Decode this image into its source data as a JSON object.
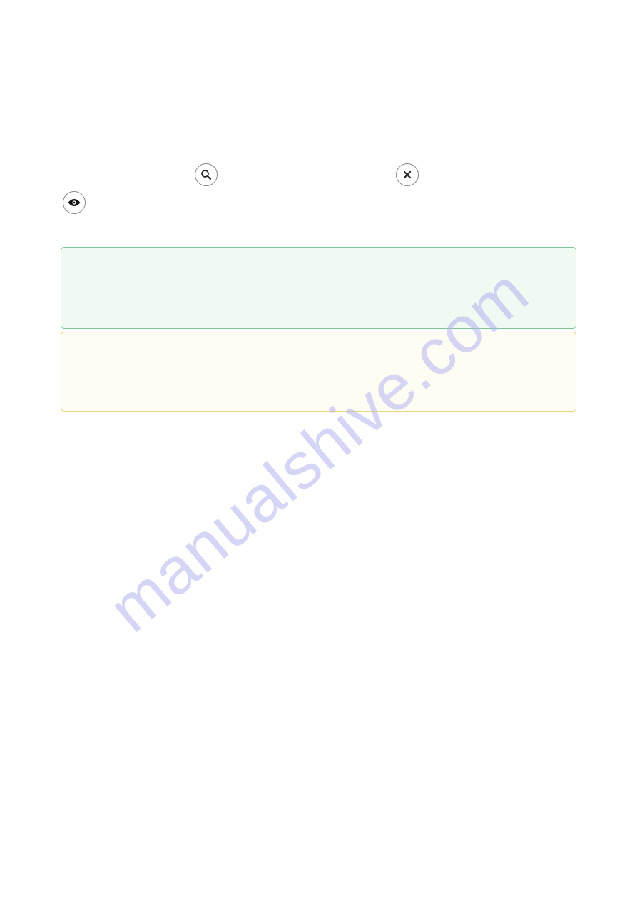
{
  "watermark": {
    "text": "manualshive.com"
  },
  "panels": {
    "success": "",
    "warning": ""
  },
  "icons": {
    "search": "search-icon",
    "close": "close-icon",
    "view": "eye-icon"
  }
}
